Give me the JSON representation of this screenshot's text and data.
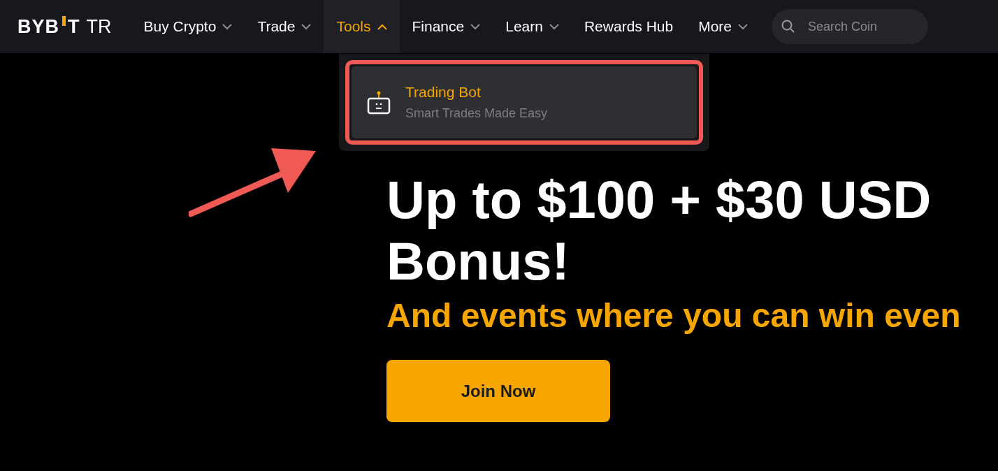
{
  "logo": {
    "left": "BYB",
    "right": "T",
    "suffix": "TR"
  },
  "nav": [
    {
      "label": "Buy Crypto",
      "has_caret": true,
      "selected": false
    },
    {
      "label": "Trade",
      "has_caret": true,
      "selected": false
    },
    {
      "label": "Tools",
      "has_caret": true,
      "selected": true
    },
    {
      "label": "Finance",
      "has_caret": true,
      "selected": false
    },
    {
      "label": "Learn",
      "has_caret": true,
      "selected": false
    },
    {
      "label": "Rewards Hub",
      "has_caret": false,
      "selected": false
    },
    {
      "label": "More",
      "has_caret": true,
      "selected": false
    }
  ],
  "search": {
    "placeholder": "Search Coin"
  },
  "dropdown": {
    "items": [
      {
        "title": "Trading Bot",
        "subtitle": "Smart Trades Made Easy",
        "highlighted": true
      }
    ]
  },
  "annotation_arrow": true,
  "hero": {
    "headline_lines": [
      "Up to $100 + $30 USD",
      "Bonus!"
    ],
    "subtitle": "And events where you can win even",
    "button": "Join Now"
  }
}
